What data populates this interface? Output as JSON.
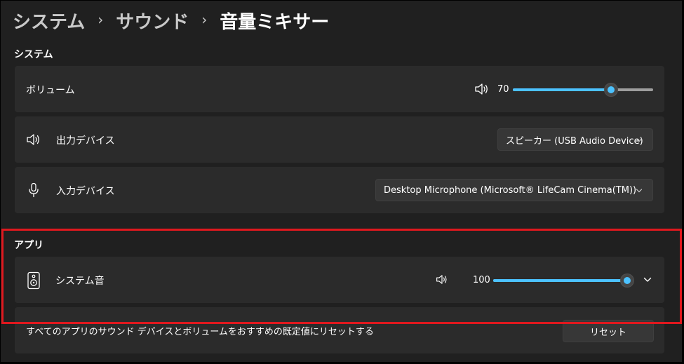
{
  "breadcrumb": {
    "items": [
      "システム",
      "サウンド",
      "音量ミキサー"
    ],
    "separator": "›"
  },
  "system_section": {
    "heading": "システム",
    "volume": {
      "label": "ボリューム",
      "value_text": "70",
      "value": 70,
      "icon": "speaker-icon"
    },
    "output": {
      "label": "出力デバイス",
      "icon": "speaker-icon",
      "selected": "スピーカー (USB Audio Device)"
    },
    "input": {
      "label": "入力デバイス",
      "icon": "microphone-icon",
      "selected": "Desktop Microphone (Microsoft® LifeCam Cinema(TM))"
    }
  },
  "apps_section": {
    "heading": "アプリ",
    "system_sounds": {
      "label": "システム音",
      "icon": "system-sounds-speaker-icon",
      "value_text": "100",
      "value": 100
    },
    "reset": {
      "description": "すべてのアプリのサウンド デバイスとボリュームをおすすめの既定値にリセットする",
      "button_label": "リセット"
    }
  },
  "colors": {
    "accent": "#4cc2ff",
    "highlight_border": "#e0181e",
    "card_bg": "#2b2b2b",
    "page_bg": "#202020"
  }
}
